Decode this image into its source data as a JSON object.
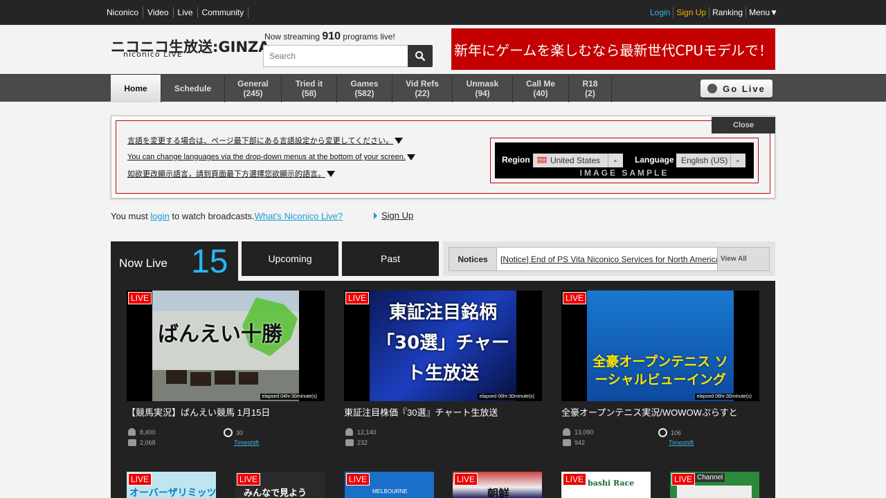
{
  "topbar": {
    "left": [
      "Niconico",
      "Video",
      "Live",
      "Community"
    ],
    "login": "Login",
    "signup": "Sign Up",
    "ranking": "Ranking",
    "menu": "Menu▼"
  },
  "header": {
    "logo_jp": "ニコニコ生放送:GINZA",
    "logo_en": "niconico LIVE",
    "streaming_prefix": "Now streaming",
    "streaming_count": "910",
    "streaming_suffix": "programs live!",
    "search_placeholder": "Search",
    "banner_text": "新年にゲームを楽しむなら最新世代CPUモデルで！"
  },
  "nav": {
    "tabs": [
      {
        "label": "Home",
        "count": ""
      },
      {
        "label": "Schedule",
        "count": ""
      },
      {
        "label": "General",
        "count": "(245)"
      },
      {
        "label": "Tried it",
        "count": "(58)"
      },
      {
        "label": "Games",
        "count": "(582)"
      },
      {
        "label": "Vid Refs",
        "count": "(22)"
      },
      {
        "label": "Unmask",
        "count": "(94)"
      },
      {
        "label": "Call Me",
        "count": "(40)"
      },
      {
        "label": "R18",
        "count": "(2)"
      }
    ],
    "golive": "Go Live"
  },
  "langpanel": {
    "close": "Close",
    "lines": [
      "言語を変更する場合は、ページ最下部にある言語設定から変更してください。",
      "You can change languages via the drop-down menus at the bottom of your screen.",
      "如欲更改顯示語言，請到頁面最下方選擇您欲顯示的語言。"
    ],
    "region_label": "Region",
    "region_value": "United States",
    "language_label": "Language",
    "language_value": "English (US)",
    "sample_caption": "IMAGE SAMPLE"
  },
  "notice_login": {
    "prefix": "You must ",
    "login": "login",
    "middle": " to watch broadcasts.",
    "whats": "What's Niconico Live?",
    "signup": "Sign Up"
  },
  "livetabs": {
    "now_live": "Now Live",
    "now_live_count": "15",
    "upcoming": "Upcoming",
    "past": "Past",
    "notices_label": "Notices",
    "notice_text": "[Notice] End of PS Vita Niconico Services for North America",
    "view_all": "View All"
  },
  "cards": [
    {
      "badge": "LIVE",
      "elapsed": "elapsed 04hr:30minute(s)",
      "title": "【競馬実況】ばんえい競馬 1月15日",
      "thumb_text": "ばんえい十勝",
      "viewers": "8,400",
      "comments": "2,068",
      "reserves": "30",
      "timeshift": "Timeshift"
    },
    {
      "badge": "LIVE",
      "elapsed": "elapsed 06hr:30minute(s)",
      "title": "東証注目株価『30選』チャート生放送",
      "thumb_text": "東証注目銘柄「30選」チャート生放送",
      "viewers": "12,140",
      "comments": "232",
      "reserves": "",
      "timeshift": ""
    },
    {
      "badge": "LIVE",
      "elapsed": "elapsed 06hr:30minute(s)",
      "title": "全豪オープンテニス実況/WOWOWぷらすと",
      "thumb_text": "全豪オープンテニス ソーシャルビューイング",
      "viewers": "13,090",
      "comments": "942",
      "reserves": "106",
      "timeshift": "Timeshift"
    }
  ],
  "small_cards": [
    {
      "badge": "LIVE",
      "text": "オーバーザリミッツ",
      "extra": ""
    },
    {
      "badge": "LIVE",
      "text": "みんなで見よう",
      "extra": ""
    },
    {
      "badge": "LIVE",
      "text": "MELBOURNE",
      "extra": ""
    },
    {
      "badge": "LIVE",
      "text": "朝鮮",
      "extra": ""
    },
    {
      "badge": "LIVE",
      "text": "bashi Race",
      "extra": ""
    },
    {
      "badge": "LIVE",
      "text": "",
      "extra": "Channel"
    }
  ],
  "colors": {
    "accent_blue": "#29b6f6",
    "live_red": "#e00000",
    "banner_red": "#c40000",
    "signup_yellow": "#f0b400"
  }
}
